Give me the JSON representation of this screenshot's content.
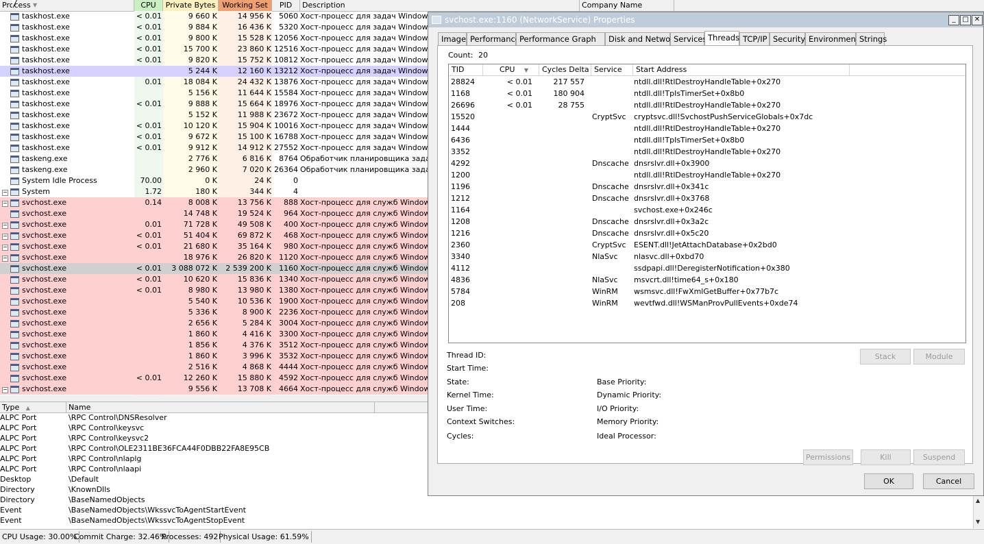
{
  "process_columns": {
    "process": "Process",
    "cpu": "CPU",
    "private_bytes": "Private Bytes",
    "working_set": "Working Set",
    "pid": "PID",
    "description": "Description",
    "company": "Company Name"
  },
  "colors": {
    "cpu_col": "#eef8ee",
    "priv_col": "#fffbe8",
    "ws_col": "#fff0e6",
    "service_row": "#ffd0d0",
    "selected_row": "#d4d0ff",
    "dark_selected_row": "#d0d0d0",
    "cpu_hdr": "#c8f0c0",
    "priv_hdr": "#fff1c0",
    "ws_hdr": "#f0a070"
  },
  "processes": [
    {
      "name": "taskhost.exe",
      "cpu": "< 0.01",
      "priv": "9 660 K",
      "ws": "14 956 K",
      "pid": "5060",
      "desc": "Хост-процесс для задач Windows",
      "style": "plain",
      "tree": ""
    },
    {
      "name": "taskhost.exe",
      "cpu": "< 0.01",
      "priv": "9 884 K",
      "ws": "16 436 K",
      "pid": "5320",
      "desc": "Хост-процесс для задач Windows",
      "style": "plain",
      "tree": ""
    },
    {
      "name": "taskhost.exe",
      "cpu": "< 0.01",
      "priv": "9 800 K",
      "ws": "15 528 K",
      "pid": "12056",
      "desc": "Хост-процесс для задач Windows",
      "style": "plain",
      "tree": ""
    },
    {
      "name": "taskhost.exe",
      "cpu": "< 0.01",
      "priv": "15 700 K",
      "ws": "23 860 K",
      "pid": "12516",
      "desc": "Хост-процесс для задач Windows",
      "style": "plain",
      "tree": ""
    },
    {
      "name": "taskhost.exe",
      "cpu": "< 0.01",
      "priv": "9 820 K",
      "ws": "15 752 K",
      "pid": "10812",
      "desc": "Хост-процесс для задач Windows",
      "style": "plain",
      "tree": ""
    },
    {
      "name": "taskhost.exe",
      "cpu": "",
      "priv": "5 244 K",
      "ws": "12 160 K",
      "pid": "13212",
      "desc": "Хост-процесс для задач Windows",
      "style": "selected",
      "tree": ""
    },
    {
      "name": "taskhost.exe",
      "cpu": "0.01",
      "priv": "18 084 K",
      "ws": "24 432 K",
      "pid": "13876",
      "desc": "Хост-процесс для задач Windows",
      "style": "plain",
      "tree": ""
    },
    {
      "name": "taskhost.exe",
      "cpu": "",
      "priv": "5 156 K",
      "ws": "11 644 K",
      "pid": "15584",
      "desc": "Хост-процесс для задач Windows",
      "style": "plain",
      "tree": ""
    },
    {
      "name": "taskhost.exe",
      "cpu": "< 0.01",
      "priv": "9 888 K",
      "ws": "15 664 K",
      "pid": "18976",
      "desc": "Хост-процесс для задач Windows",
      "style": "plain",
      "tree": ""
    },
    {
      "name": "taskhost.exe",
      "cpu": "",
      "priv": "5 152 K",
      "ws": "11 988 K",
      "pid": "23672",
      "desc": "Хост-процесс для задач Windows",
      "style": "plain",
      "tree": ""
    },
    {
      "name": "taskhost.exe",
      "cpu": "< 0.01",
      "priv": "10 120 K",
      "ws": "15 904 K",
      "pid": "10016",
      "desc": "Хост-процесс для задач Windows",
      "style": "plain",
      "tree": ""
    },
    {
      "name": "taskhost.exe",
      "cpu": "< 0.01",
      "priv": "9 672 K",
      "ws": "15 100 K",
      "pid": "16788",
      "desc": "Хост-процесс для задач Windows",
      "style": "plain",
      "tree": ""
    },
    {
      "name": "taskhost.exe",
      "cpu": "< 0.01",
      "priv": "9 912 K",
      "ws": "14 912 K",
      "pid": "27552",
      "desc": "Хост-процесс для задач Windows",
      "style": "plain",
      "tree": ""
    },
    {
      "name": "taskeng.exe",
      "cpu": "",
      "priv": "2 776 K",
      "ws": "6 816 K",
      "pid": "8764",
      "desc": "Обработчик планировщика заданий",
      "style": "plain",
      "tree": ""
    },
    {
      "name": "taskeng.exe",
      "cpu": "",
      "priv": "2 960 K",
      "ws": "7 020 K",
      "pid": "26364",
      "desc": "Обработчик планировщика заданий",
      "style": "plain",
      "tree": ""
    },
    {
      "name": "System Idle Process",
      "cpu": "70.00",
      "priv": "0 K",
      "ws": "24 K",
      "pid": "0",
      "desc": "",
      "style": "plain",
      "tree": ""
    },
    {
      "name": "System",
      "cpu": "1.72",
      "priv": "180 K",
      "ws": "344 K",
      "pid": "4",
      "desc": "",
      "style": "plain",
      "tree": "−"
    },
    {
      "name": "svchost.exe",
      "cpu": "0.14",
      "priv": "8 008 K",
      "ws": "13 756 K",
      "pid": "888",
      "desc": "Хост-процесс для служб Windows",
      "style": "service",
      "tree": "−"
    },
    {
      "name": "svchost.exe",
      "cpu": "",
      "priv": "14 748 K",
      "ws": "19 524 K",
      "pid": "964",
      "desc": "Хост-процесс для служб Windows",
      "style": "service",
      "tree": ""
    },
    {
      "name": "svchost.exe",
      "cpu": "0.01",
      "priv": "71 728 K",
      "ws": "49 508 K",
      "pid": "400",
      "desc": "Хост-процесс для служб Windows",
      "style": "service",
      "tree": "−"
    },
    {
      "name": "svchost.exe",
      "cpu": "< 0.01",
      "priv": "51 404 K",
      "ws": "69 872 K",
      "pid": "468",
      "desc": "Хост-процесс для служб Windows",
      "style": "service",
      "tree": "−"
    },
    {
      "name": "svchost.exe",
      "cpu": "< 0.01",
      "priv": "21 680 K",
      "ws": "35 164 K",
      "pid": "980",
      "desc": "Хост-процесс для служб Windows",
      "style": "service",
      "tree": "−"
    },
    {
      "name": "svchost.exe",
      "cpu": "",
      "priv": "18 976 K",
      "ws": "26 820 K",
      "pid": "1120",
      "desc": "Хост-процесс для служб Windows",
      "style": "service",
      "tree": "−"
    },
    {
      "name": "svchost.exe",
      "cpu": "< 0.01",
      "priv": "3 088 072 K",
      "ws": "2 539 200 K",
      "pid": "1160",
      "desc": "Хост-процесс для служб Windows",
      "style": "gray",
      "tree": ""
    },
    {
      "name": "svchost.exe",
      "cpu": "< 0.01",
      "priv": "10 620 K",
      "ws": "15 836 K",
      "pid": "1340",
      "desc": "Хост-процесс для служб Windows",
      "style": "service",
      "tree": ""
    },
    {
      "name": "svchost.exe",
      "cpu": "< 0.01",
      "priv": "8 980 K",
      "ws": "13 980 K",
      "pid": "1380",
      "desc": "Хост-процесс для служб Windows",
      "style": "service",
      "tree": ""
    },
    {
      "name": "svchost.exe",
      "cpu": "",
      "priv": "5 540 K",
      "ws": "10 536 K",
      "pid": "1900",
      "desc": "Хост-процесс для служб Windows",
      "style": "service",
      "tree": ""
    },
    {
      "name": "svchost.exe",
      "cpu": "",
      "priv": "5 336 K",
      "ws": "8 900 K",
      "pid": "2236",
      "desc": "Хост-процесс для служб Windows",
      "style": "service",
      "tree": ""
    },
    {
      "name": "svchost.exe",
      "cpu": "",
      "priv": "2 656 K",
      "ws": "5 284 K",
      "pid": "3004",
      "desc": "Хост-процесс для служб Windows",
      "style": "service",
      "tree": ""
    },
    {
      "name": "svchost.exe",
      "cpu": "",
      "priv": "1 860 K",
      "ws": "4 416 K",
      "pid": "3300",
      "desc": "Хост-процесс для служб Windows",
      "style": "service",
      "tree": ""
    },
    {
      "name": "svchost.exe",
      "cpu": "",
      "priv": "1 856 K",
      "ws": "4 376 K",
      "pid": "3512",
      "desc": "Хост-процесс для служб Windows",
      "style": "service",
      "tree": ""
    },
    {
      "name": "svchost.exe",
      "cpu": "",
      "priv": "1 860 K",
      "ws": "3 996 K",
      "pid": "3532",
      "desc": "Хост-процесс для служб Windows",
      "style": "service",
      "tree": ""
    },
    {
      "name": "svchost.exe",
      "cpu": "",
      "priv": "2 516 K",
      "ws": "4 868 K",
      "pid": "4444",
      "desc": "Хост-процесс для служб Windows",
      "style": "service",
      "tree": ""
    },
    {
      "name": "svchost.exe",
      "cpu": "< 0.01",
      "priv": "12 260 K",
      "ws": "15 880 K",
      "pid": "4592",
      "desc": "Хост-процесс для служб Windows",
      "style": "service",
      "tree": ""
    },
    {
      "name": "svchost.exe",
      "cpu": "",
      "priv": "9 556 K",
      "ws": "13 708 K",
      "pid": "4664",
      "desc": "Хост-процесс для служб Windows",
      "style": "service",
      "tree": "−"
    }
  ],
  "handles_columns": {
    "type": "Type",
    "name": "Name"
  },
  "handles": [
    {
      "type": "ALPC Port",
      "name": "\\RPC Control\\DNSResolver"
    },
    {
      "type": "ALPC Port",
      "name": "\\RPC Control\\keysvc"
    },
    {
      "type": "ALPC Port",
      "name": "\\RPC Control\\keysvc2"
    },
    {
      "type": "ALPC Port",
      "name": "\\RPC Control\\OLE2311BE36FCA44F0DBB22FA8E95CB"
    },
    {
      "type": "ALPC Port",
      "name": "\\RPC Control\\nlaplg"
    },
    {
      "type": "ALPC Port",
      "name": "\\RPC Control\\nlaapi"
    },
    {
      "type": "Desktop",
      "name": "\\Default"
    },
    {
      "type": "Directory",
      "name": "\\KnownDlls"
    },
    {
      "type": "Directory",
      "name": "\\BaseNamedObjects"
    },
    {
      "type": "Event",
      "name": "\\BaseNamedObjects\\WkssvcToAgentStartEvent"
    },
    {
      "type": "Event",
      "name": "\\BaseNamedObjects\\WkssvcToAgentStopEvent"
    }
  ],
  "status": {
    "cpu": "CPU Usage: 30.00%",
    "commit": "Commit Charge: 32.46%",
    "processes": "Processes: 492",
    "physical": "Physical Usage: 61.59%"
  },
  "dialog": {
    "title": "svchost.exe:1160 (NetworkService) Properties",
    "tabs": [
      "Image",
      "Performance",
      "Performance Graph",
      "Disk and Network",
      "Services",
      "Threads",
      "TCP/IP",
      "Security",
      "Environment",
      "Strings"
    ],
    "active_tab": "Threads",
    "count_label": "Count:",
    "count_value": "20",
    "thread_columns": {
      "tid": "TID",
      "cpu": "CPU",
      "cycles": "Cycles Delta",
      "service": "Service",
      "start": "Start Address"
    },
    "threads": [
      {
        "tid": "28824",
        "cpu": "< 0.01",
        "cycles": "217 557",
        "service": "",
        "start": "ntdll.dll!RtlDestroyHandleTable+0x270"
      },
      {
        "tid": "1168",
        "cpu": "< 0.01",
        "cycles": "180 904",
        "service": "",
        "start": "ntdll.dll!TpIsTimerSet+0x8b0"
      },
      {
        "tid": "26696",
        "cpu": "< 0.01",
        "cycles": "28 755",
        "service": "",
        "start": "ntdll.dll!RtlDestroyHandleTable+0x270"
      },
      {
        "tid": "15520",
        "cpu": "",
        "cycles": "",
        "service": "CryptSvc",
        "start": "cryptsvc.dll!SvchostPushServiceGlobals+0x7dc"
      },
      {
        "tid": "1444",
        "cpu": "",
        "cycles": "",
        "service": "",
        "start": "ntdll.dll!RtlDestroyHandleTable+0x270"
      },
      {
        "tid": "6436",
        "cpu": "",
        "cycles": "",
        "service": "",
        "start": "ntdll.dll!TpIsTimerSet+0x8b0"
      },
      {
        "tid": "3352",
        "cpu": "",
        "cycles": "",
        "service": "",
        "start": "ntdll.dll!RtlDestroyHandleTable+0x270"
      },
      {
        "tid": "4292",
        "cpu": "",
        "cycles": "",
        "service": "Dnscache",
        "start": "dnsrslvr.dll+0x3900"
      },
      {
        "tid": "1200",
        "cpu": "",
        "cycles": "",
        "service": "",
        "start": "ntdll.dll!RtlDestroyHandleTable+0x270"
      },
      {
        "tid": "1196",
        "cpu": "",
        "cycles": "",
        "service": "Dnscache",
        "start": "dnsrslvr.dll+0x341c"
      },
      {
        "tid": "1212",
        "cpu": "",
        "cycles": "",
        "service": "Dnscache",
        "start": "dnsrslvr.dll+0x3768"
      },
      {
        "tid": "1164",
        "cpu": "",
        "cycles": "",
        "service": "",
        "start": "svchost.exe+0x246c"
      },
      {
        "tid": "1208",
        "cpu": "",
        "cycles": "",
        "service": "Dnscache",
        "start": "dnsrslvr.dll+0x3a2c"
      },
      {
        "tid": "1216",
        "cpu": "",
        "cycles": "",
        "service": "Dnscache",
        "start": "dnsrslvr.dll+0x5c20"
      },
      {
        "tid": "2360",
        "cpu": "",
        "cycles": "",
        "service": "CryptSvc",
        "start": "ESENT.dll!JetAttachDatabase+0x2bd0"
      },
      {
        "tid": "3340",
        "cpu": "",
        "cycles": "",
        "service": "NlaSvc",
        "start": "nlasvc.dll+0xbd70"
      },
      {
        "tid": "4112",
        "cpu": "",
        "cycles": "",
        "service": "",
        "start": "ssdpapi.dll!DeregisterNotification+0x380"
      },
      {
        "tid": "4836",
        "cpu": "",
        "cycles": "",
        "service": "NlaSvc",
        "start": "msvcrt.dll!time64_s+0x180"
      },
      {
        "tid": "5784",
        "cpu": "",
        "cycles": "",
        "service": "WinRM",
        "start": "wsmsvc.dll!FwXmlGetBuffer+0x77b7c"
      },
      {
        "tid": "208",
        "cpu": "",
        "cycles": "",
        "service": "WinRM",
        "start": "wevtfwd.dll!WSManProvPullEvents+0xde74"
      }
    ],
    "details_left": [
      "Thread ID:",
      "Start Time:",
      "State:",
      "Kernel Time:",
      "User Time:",
      "Context Switches:",
      "Cycles:"
    ],
    "details_right": [
      "Base Priority:",
      "Dynamic Priority:",
      "I/O Priority:",
      "Memory Priority:",
      "Ideal Processor:"
    ],
    "buttons": {
      "stack": "Stack",
      "module": "Module",
      "permissions": "Permissions",
      "kill": "Kill",
      "suspend": "Suspend",
      "ok": "OK",
      "cancel": "Cancel"
    }
  }
}
